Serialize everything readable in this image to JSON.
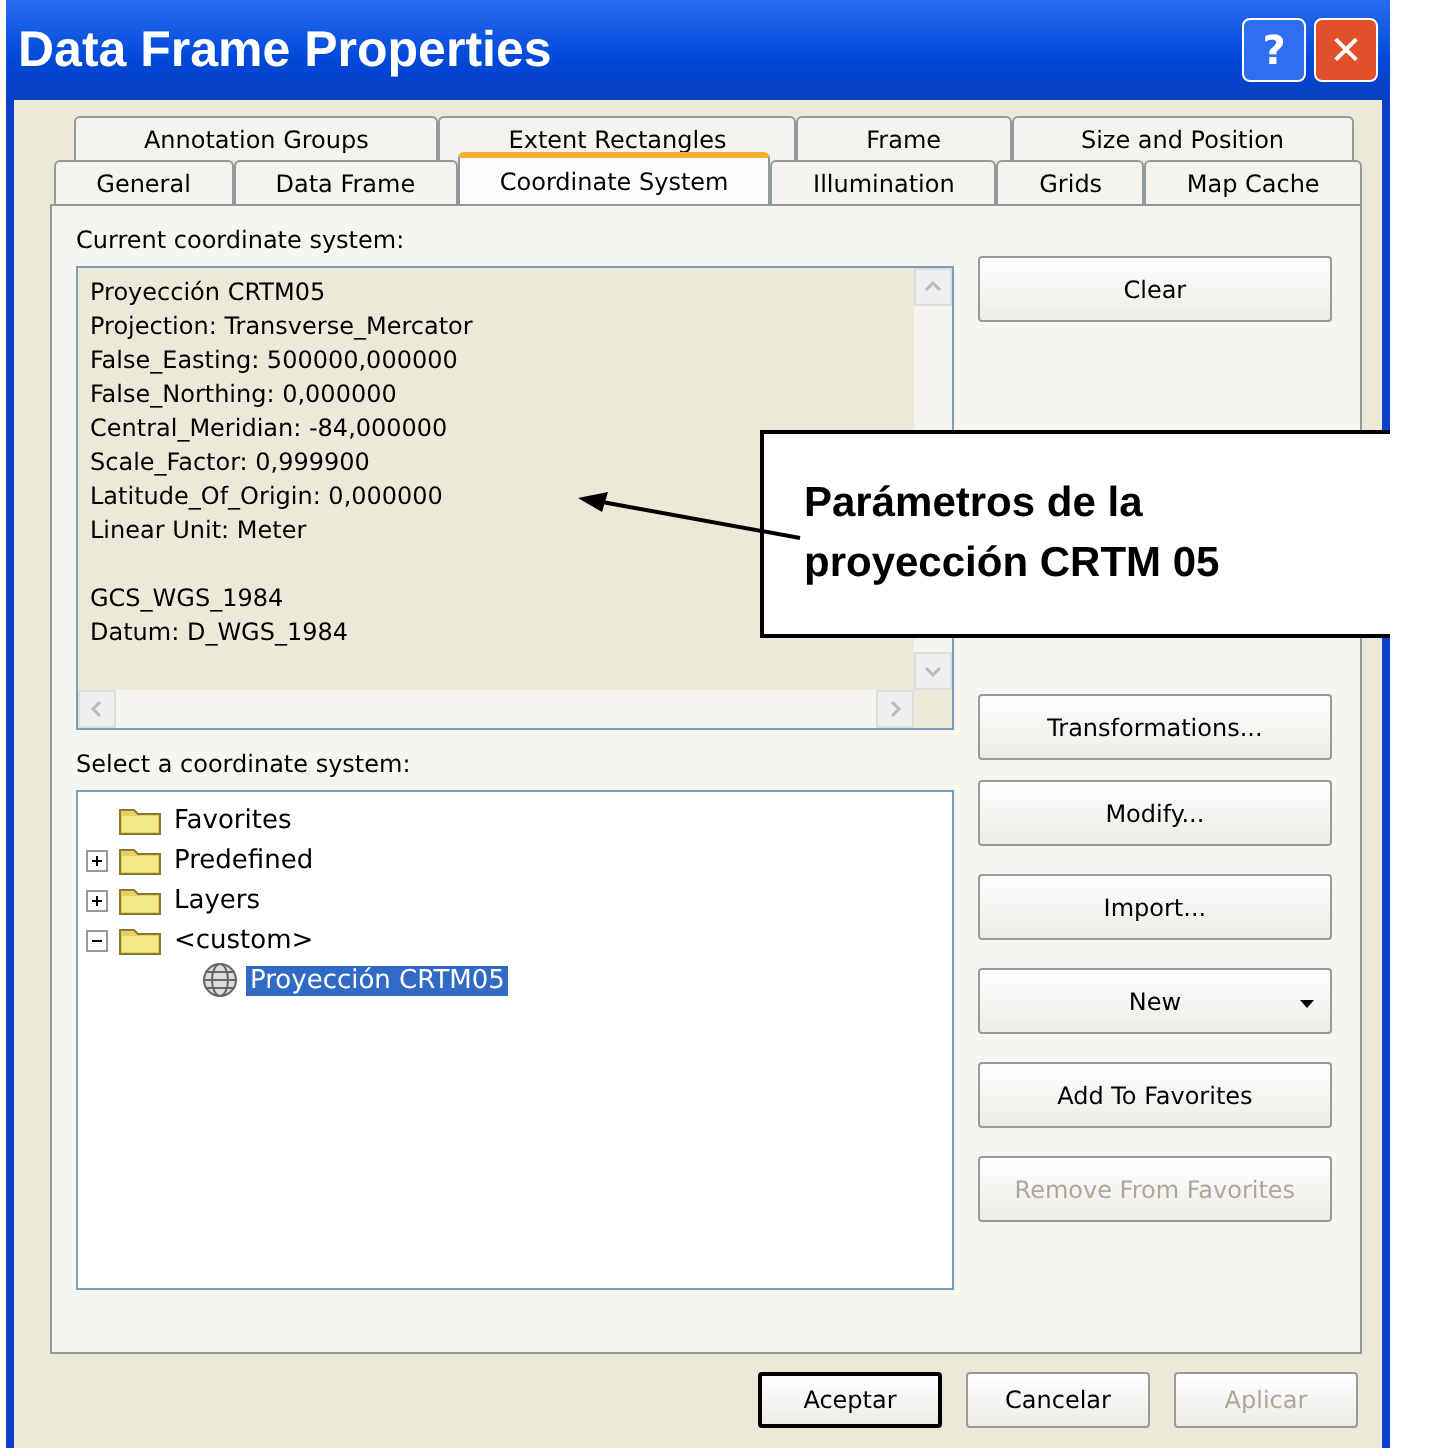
{
  "window": {
    "title": "Data Frame Properties",
    "help_label": "?",
    "close_label": "✕"
  },
  "tabs": [
    {
      "row": [
        {
          "label": "Annotation Groups",
          "selected": false
        },
        {
          "label": "Extent Rectangles",
          "selected": false
        },
        {
          "label": "Frame",
          "selected": false
        },
        {
          "label": "Size and Position",
          "selected": false
        }
      ]
    },
    {
      "row": [
        {
          "label": "General",
          "selected": false
        },
        {
          "label": "Data Frame",
          "selected": false
        },
        {
          "label": "Coordinate System",
          "selected": true
        },
        {
          "label": "Illumination",
          "selected": false
        },
        {
          "label": "Grids",
          "selected": false
        },
        {
          "label": "Map Cache",
          "selected": false
        }
      ]
    }
  ],
  "current_system": {
    "label": "Current coordinate system:",
    "paragraphs": [
      [
        "Proyección CRTM05",
        "Projection: Transverse_Mercator",
        "False_Easting: 500000,000000",
        "False_Northing: 0,000000",
        "Central_Meridian: -84,000000",
        "Scale_Factor: 0,999900",
        "Latitude_Of_Origin: 0,000000",
        "Linear Unit: Meter"
      ],
      [
        "GCS_WGS_1984",
        "Datum: D_WGS_1984"
      ]
    ]
  },
  "select_system": {
    "label": "Select a coordinate system:",
    "tree": [
      {
        "label": "Favorites",
        "kind": "folder",
        "selected": false
      },
      {
        "label": "Predefined",
        "kind": "folder",
        "expanded": false,
        "selected": false
      },
      {
        "label": "Layers",
        "kind": "folder",
        "expanded": false,
        "selected": false
      },
      {
        "label": "<custom>",
        "kind": "folder",
        "expanded": true,
        "selected": false,
        "children": [
          {
            "label": "Proyección CRTM05",
            "kind": "projection",
            "selected": true
          }
        ]
      }
    ]
  },
  "side_buttons": [
    {
      "label": "Clear",
      "kind": "plain",
      "disabled": false
    },
    {
      "label": "Transformations...",
      "kind": "plain",
      "disabled": false
    },
    {
      "label": "Modify...",
      "kind": "plain",
      "disabled": false
    },
    {
      "label": "Import...",
      "kind": "plain",
      "disabled": false
    },
    {
      "label": "New",
      "kind": "menu",
      "disabled": false
    },
    {
      "label": "Add To Favorites",
      "kind": "plain",
      "disabled": false
    },
    {
      "label": "Remove From Favorites",
      "kind": "plain",
      "disabled": true
    }
  ],
  "callout": {
    "lines": [
      "Parámetros de la",
      "proyección CRTM 05"
    ]
  },
  "footer_buttons": [
    {
      "label": "Aceptar",
      "default": true,
      "disabled": false
    },
    {
      "label": "Cancelar",
      "default": false,
      "disabled": false
    },
    {
      "label": "Aplicar",
      "default": false,
      "disabled": true
    }
  ]
}
